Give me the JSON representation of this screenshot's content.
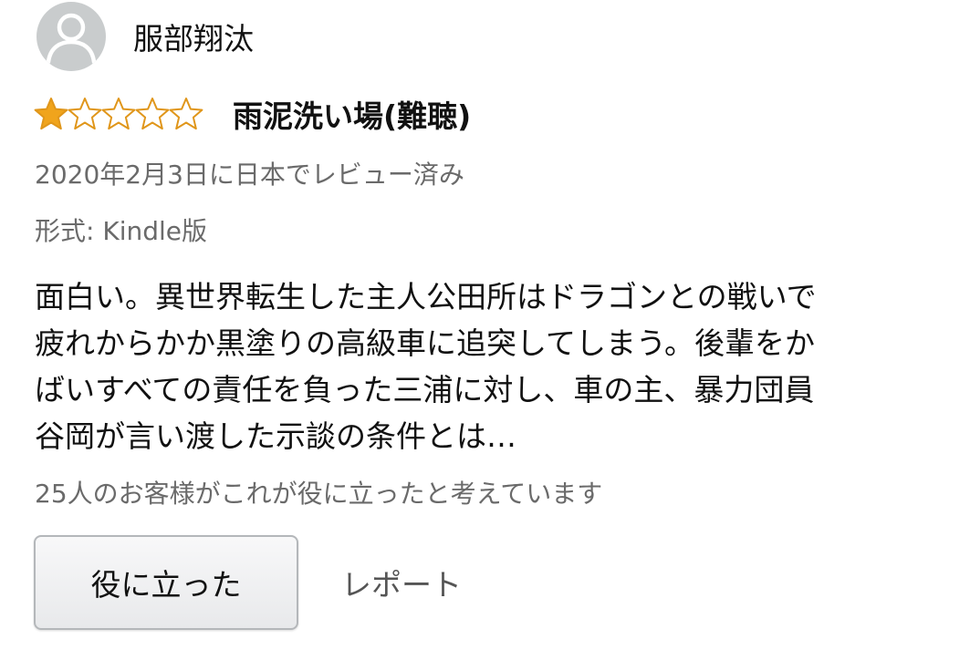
{
  "reviewer": {
    "name": "服部翔汰",
    "avatar_icon": "person-silhouette-icon"
  },
  "rating": {
    "stars": 1,
    "max_stars": 5,
    "filled_color": "#f0a41c",
    "outline_color": "#e0961a"
  },
  "review": {
    "title": "雨泥洗い場(難聴)",
    "date_text": "2020年2月3日に日本でレビュー済み",
    "format_text": "形式: Kindle版",
    "body_lines": [
      "面白い。異世界転生した主人公田所はドラゴンとの戦いで",
      "疲れからかか黒塗りの高級車に追突してしまう。後輩をか",
      "ばいすべての責任を負った三浦に対し、車の主、暴力団員",
      "谷岡が言い渡した示談の条件とは…"
    ],
    "helpful_count_text": "25人のお客様がこれが役に立ったと考えています"
  },
  "actions": {
    "helpful_label": "役に立った",
    "report_label": "レポート"
  }
}
